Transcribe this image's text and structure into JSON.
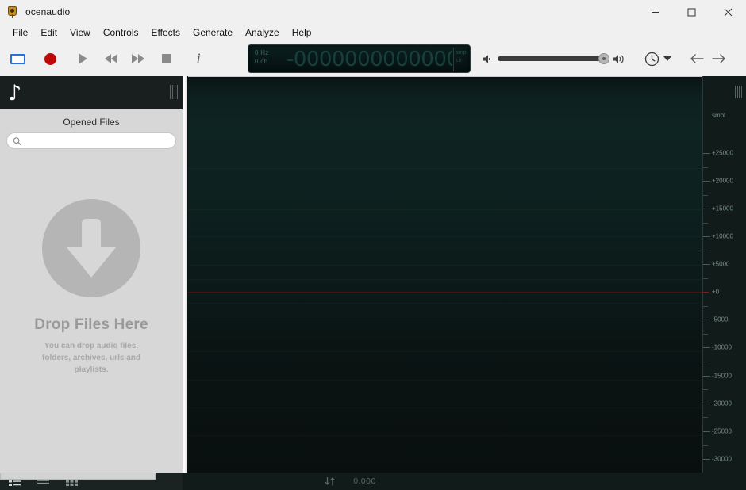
{
  "window": {
    "title": "ocenaudio",
    "app_icon": "ocenaudio-logo-icon",
    "minimize_label": "Minimize",
    "maximize_label": "Maximize",
    "close_label": "Close"
  },
  "menubar": {
    "items": [
      {
        "label": "File"
      },
      {
        "label": "Edit"
      },
      {
        "label": "View"
      },
      {
        "label": "Controls"
      },
      {
        "label": "Effects"
      },
      {
        "label": "Generate"
      },
      {
        "label": "Analyze"
      },
      {
        "label": "Help"
      }
    ]
  },
  "toolbar": {
    "buttons": [
      {
        "name": "selection-tool-button",
        "label": "Selection"
      },
      {
        "name": "record-button",
        "label": "Record"
      },
      {
        "name": "play-button",
        "label": "Play"
      },
      {
        "name": "rewind-button",
        "label": "Rewind"
      },
      {
        "name": "fast-forward-button",
        "label": "Fast Forward"
      },
      {
        "name": "stop-button",
        "label": "Stop"
      },
      {
        "name": "info-button",
        "label": "Information"
      }
    ],
    "lcd": {
      "sample_rate": "0 Hz",
      "channels": "0 ch",
      "time_display": "-0000000000000",
      "unit_top": "smpl",
      "unit_bottom": "ch"
    },
    "volume": {
      "min_icon": "speaker-low-icon",
      "max_icon": "speaker-high-icon",
      "value": 100
    },
    "clock_label": "History",
    "back_label": "Back",
    "forward_label": "Forward"
  },
  "sidebar": {
    "logo": "music-note-icon",
    "grip": "panel-grip-icon",
    "title": "Opened Files",
    "search": {
      "value": "",
      "placeholder": "",
      "icon": "search-icon"
    },
    "dropzone": {
      "icon": "download-arrow-icon",
      "title": "Drop Files Here",
      "subtitle": "You can drop audio files, folders, archives, urls and playlists."
    },
    "view_modes": [
      {
        "name": "view-mode-details-button",
        "label": "Details view"
      },
      {
        "name": "view-mode-list-button",
        "label": "List view"
      },
      {
        "name": "view-mode-grid-button",
        "label": "Grid view"
      }
    ]
  },
  "waveform": {
    "ruler_unit": "smpl",
    "ruler_labels": [
      "+25000",
      "+20000",
      "+15000",
      "+10000",
      "+5000",
      "+0",
      "-5000",
      "-10000",
      "-15000",
      "-20000",
      "-25000",
      "-30000"
    ],
    "zero_line_color": "#4a1414",
    "background_color": "#0b1313",
    "accent_color": "#0e2422"
  },
  "statusbar": {
    "sort_icon": "sort-arrows-icon",
    "time": "0.000"
  }
}
